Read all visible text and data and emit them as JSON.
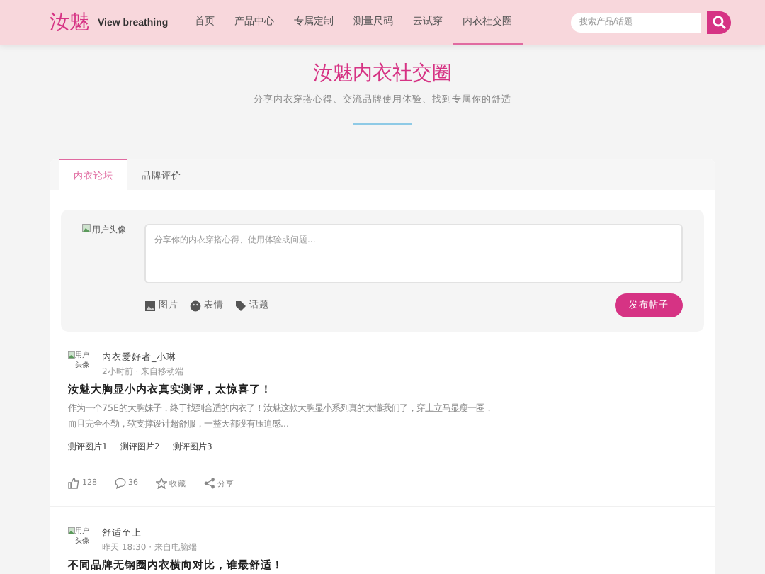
{
  "header": {
    "logo": "汝魅",
    "slogan": "View breathing",
    "nav": [
      {
        "label": "首页",
        "selected": false
      },
      {
        "label": "产品中心",
        "selected": false
      },
      {
        "label": "专属定制",
        "selected": false
      },
      {
        "label": "测量尺码",
        "selected": false
      },
      {
        "label": "云试穿",
        "selected": false
      },
      {
        "label": "内衣社交圈",
        "selected": true
      }
    ],
    "search": {
      "placeholder": "搜索产品/话题"
    }
  },
  "hero": {
    "title": "汝魅内衣社交圈",
    "subtitle": "分享内衣穿搭心得、交流品牌使用体验、找到专属你的舒适"
  },
  "tabs": [
    {
      "label": "内衣论坛",
      "selected": true
    },
    {
      "label": "品牌评价",
      "selected": false
    }
  ],
  "composer": {
    "avatar_alt": "用户头像",
    "placeholder": "分享你的内衣穿搭心得、使用体验或问题...",
    "tools": [
      {
        "kind": "image",
        "label": "图片"
      },
      {
        "kind": "emoji",
        "label": "表情"
      },
      {
        "kind": "topic",
        "label": "话题"
      }
    ],
    "submit": "发布帖子"
  },
  "posts": [
    {
      "avatar_alt": "用户头像",
      "author": "内衣爱好者_小琳",
      "meta": "2小时前 · 来自移动端",
      "title": "汝魅大胸显小内衣真实测评，太惊喜了！",
      "body": "作为一个75E的大胸妹子，终于找到合适的内衣了！汝魅这款大胸显小系列真的太懂我们了，穿上立马显瘦一圈，而且完全不勒，软支撑设计超舒服，一整天都没有压迫感...",
      "images": [
        "测评图片1",
        "测评图片2",
        "测评图片3"
      ],
      "likes": "128",
      "comments": "36",
      "favorite": "收藏",
      "share": "分享"
    },
    {
      "avatar_alt": "用户头像",
      "author": "舒适至上",
      "meta": "昨天 18:30 · 来自电脑端",
      "title": "不同品牌无钢圈内衣横向对比，谁最舒适！"
    }
  ]
}
